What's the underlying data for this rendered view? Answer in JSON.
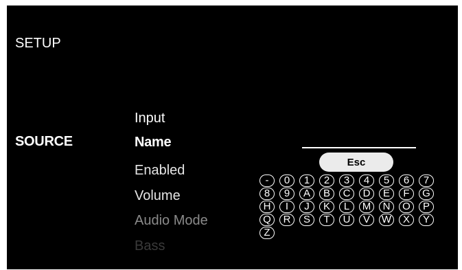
{
  "screen": {
    "title": "SETUP",
    "section_label": "SOURCE"
  },
  "menu": {
    "items": [
      {
        "label": "Input",
        "state": "normal"
      },
      {
        "label": "Name",
        "state": "selected"
      },
      {
        "label": "Enabled",
        "state": "normal"
      },
      {
        "label": "Volume",
        "state": "dim"
      },
      {
        "label": "Audio Mode",
        "state": "dimmer"
      },
      {
        "label": "Bass",
        "state": "faded"
      }
    ]
  },
  "name_entry": {
    "value": "",
    "esc_label": "Esc"
  },
  "keyboard": {
    "rows": [
      [
        "-",
        "0",
        "1",
        "2",
        "3",
        "4",
        "5",
        "6",
        "7"
      ],
      [
        "8",
        "9",
        "A",
        "B",
        "C",
        "D",
        "E",
        "F",
        "G"
      ],
      [
        "H",
        "I",
        "J",
        "K",
        "L",
        "M",
        "N",
        "O",
        "P"
      ],
      [
        "Q",
        "R",
        "S",
        "T",
        "U",
        "V",
        "W",
        "X",
        "Y"
      ],
      [
        "Z"
      ]
    ]
  }
}
